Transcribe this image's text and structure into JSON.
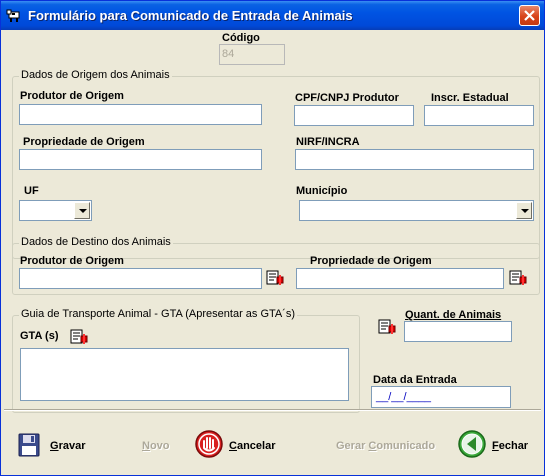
{
  "window": {
    "title": "Formulário para Comunicado de Entrada de Animais"
  },
  "codigo": {
    "label": "Código",
    "value": "84"
  },
  "origem": {
    "title": "Dados de Origem dos Animais",
    "produtor_label": "Produtor de Origem",
    "cpf_label": "CPF/CNPJ Produtor",
    "inscr_label": "Inscr. Estadual",
    "propriedade_label": "Propriedade de Origem",
    "nirf_label": "NIRF/INCRA",
    "uf_label": "UF",
    "municipio_label": "Município"
  },
  "destino": {
    "title": "Dados de Destino dos Animais",
    "produtor_label": "Produtor de Origem",
    "propriedade_label": "Propriedade de Origem"
  },
  "gta": {
    "title": "Guia de Transporte Animal - GTA (Apresentar as GTA´s)",
    "gta_label": "GTA (s)"
  },
  "quantidade": {
    "label": "Quant. de Animais"
  },
  "data_entrada": {
    "label": "Data da Entrada",
    "value": "__/__/____"
  },
  "toolbar": {
    "gravar_pre": "G",
    "gravar_rest": "ravar",
    "novo_pre": "N",
    "novo_rest": "ovo",
    "cancelar_pre": "C",
    "cancelar_rest": "ancelar",
    "gerar_pre": "Gerar ",
    "gerar_u": "C",
    "gerar_rest": "omunicado",
    "fechar_pre": "F",
    "fechar_rest": "echar"
  },
  "icons": {
    "title": "cow-icon",
    "close": "close-icon",
    "gravar": "floppy-disk-icon",
    "cancelar": "stop-hand-icon",
    "fechar": "back-arrow-icon",
    "pick": "search-record-icon"
  }
}
